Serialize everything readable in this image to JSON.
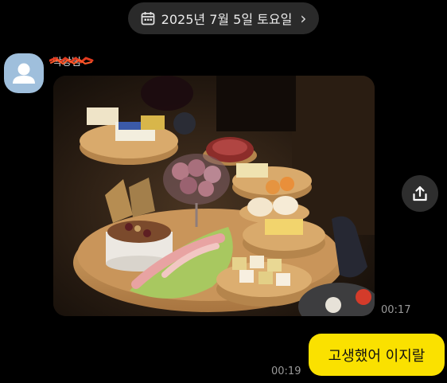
{
  "header": {
    "date_label": "2025년 7월 5일 토요일",
    "calendar_icon": "calendar-icon",
    "chevron_icon": "chevron-right-icon"
  },
  "incoming": {
    "sender_name": "박상범",
    "photo_description": "cheese and charcuterie platter",
    "time": "00:17",
    "share_icon": "share-icon"
  },
  "outgoing": {
    "text": "고생했어 이지랄",
    "time": "00:19"
  },
  "colors": {
    "background": "#000000",
    "my_bubble": "#fae100",
    "avatar": "#9fbfdc",
    "pill": "#2a2a2a"
  }
}
